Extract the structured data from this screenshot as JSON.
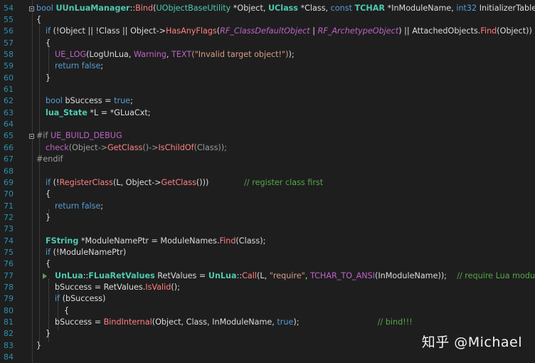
{
  "editor": {
    "lines": [
      {
        "n": "54",
        "segs": [
          [
            "kw",
            "bool "
          ],
          [
            "tyb",
            "UUnLuaManager"
          ],
          [
            "id",
            "::"
          ],
          [
            "fn",
            "Bind"
          ],
          [
            "id",
            "("
          ],
          [
            "ty",
            "UObjectBaseUtility"
          ],
          [
            "id",
            " *Object, "
          ],
          [
            "tyb",
            "UClass"
          ],
          [
            "id",
            " *Class, "
          ],
          [
            "kw",
            "const "
          ],
          [
            "tyb",
            "TCHAR"
          ],
          [
            "id",
            " *InModuleName, "
          ],
          [
            "kw",
            "int32"
          ],
          [
            "id",
            " InitializerTableRef)"
          ]
        ]
      },
      {
        "n": "55",
        "segs": [
          [
            "id",
            "{"
          ]
        ]
      },
      {
        "n": "56",
        "segs": [
          [
            "kw",
            "if "
          ],
          [
            "id",
            "(!Object || !Class || Object->"
          ],
          [
            "fn",
            "HasAnyFlags"
          ],
          [
            "id",
            "("
          ],
          [
            "macb",
            "RF_ClassDefaultObject"
          ],
          [
            "id",
            " | "
          ],
          [
            "macb",
            "RF_ArchetypeObject"
          ],
          [
            "id",
            ") || AttachedObjects."
          ],
          [
            "fn",
            "Find"
          ],
          [
            "id",
            "(Object))"
          ]
        ]
      },
      {
        "n": "57",
        "segs": [
          [
            "id",
            "{"
          ]
        ]
      },
      {
        "n": "58",
        "segs": [
          [
            "mac",
            "UE_LOG"
          ],
          [
            "id",
            "(LogUnLua, "
          ],
          [
            "mac",
            "Warning"
          ],
          [
            "id",
            ", "
          ],
          [
            "mac",
            "TEXT"
          ],
          [
            "str",
            "(\"Invalid target object!\")"
          ],
          [
            "id",
            ");"
          ]
        ]
      },
      {
        "n": "59",
        "segs": [
          [
            "kw",
            "return false"
          ],
          [
            "id",
            ";"
          ]
        ]
      },
      {
        "n": "60",
        "segs": [
          [
            "id",
            "}"
          ]
        ]
      },
      {
        "n": "61",
        "segs": []
      },
      {
        "n": "62",
        "segs": [
          [
            "kw",
            "bool "
          ],
          [
            "id",
            "bSuccess = "
          ],
          [
            "kw",
            "true"
          ],
          [
            "id",
            ";"
          ]
        ]
      },
      {
        "n": "63",
        "segs": [
          [
            "tyb",
            "lua_State"
          ],
          [
            "id",
            " *L = *GLuaCxt;"
          ]
        ]
      },
      {
        "n": "64",
        "segs": []
      },
      {
        "n": "65",
        "segs": [
          [
            "pp",
            "#if "
          ],
          [
            "mac",
            "UE_BUILD_DEBUG"
          ]
        ]
      },
      {
        "n": "66",
        "segs": [
          [
            "mac",
            "check"
          ],
          [
            "pp",
            "(Object->"
          ],
          [
            "fn",
            "GetClass"
          ],
          [
            "pp",
            "()->"
          ],
          [
            "fn",
            "IsChildOf"
          ],
          [
            "pp",
            "(Class));"
          ]
        ]
      },
      {
        "n": "67",
        "segs": [
          [
            "pp",
            "#endif"
          ]
        ]
      },
      {
        "n": "68",
        "segs": []
      },
      {
        "n": "69",
        "segs": [
          [
            "kw",
            "if "
          ],
          [
            "id",
            "(!"
          ],
          [
            "fn",
            "RegisterClass"
          ],
          [
            "id",
            "(L, Object->"
          ],
          [
            "fn",
            "GetClass"
          ],
          [
            "id",
            "()))              "
          ],
          [
            "cm",
            "// register class first"
          ]
        ]
      },
      {
        "n": "70",
        "segs": [
          [
            "id",
            "{"
          ]
        ]
      },
      {
        "n": "71",
        "segs": [
          [
            "kw",
            "return false"
          ],
          [
            "id",
            ";"
          ]
        ]
      },
      {
        "n": "72",
        "segs": [
          [
            "id",
            "}"
          ]
        ]
      },
      {
        "n": "73",
        "segs": []
      },
      {
        "n": "74",
        "segs": [
          [
            "tyb",
            "FString"
          ],
          [
            "id",
            " *ModuleNamePtr = ModuleNames."
          ],
          [
            "fn",
            "Find"
          ],
          [
            "id",
            "(Class);"
          ]
        ]
      },
      {
        "n": "75",
        "segs": [
          [
            "kw",
            "if "
          ],
          [
            "id",
            "(!ModuleNamePtr)"
          ]
        ]
      },
      {
        "n": "76",
        "segs": [
          [
            "id",
            "{"
          ]
        ]
      },
      {
        "n": "77",
        "segs": [
          [
            "tyb",
            "UnLua"
          ],
          [
            "id",
            "::"
          ],
          [
            "tyb",
            "FLuaRetValues"
          ],
          [
            "id",
            " RetValues = "
          ],
          [
            "tyb",
            "UnLua"
          ],
          [
            "id",
            "::"
          ],
          [
            "fn",
            "Call"
          ],
          [
            "id",
            "(L, "
          ],
          [
            "str",
            "\"require\""
          ],
          [
            "id",
            ", "
          ],
          [
            "mac",
            "TCHAR_TO_ANSI"
          ],
          [
            "id",
            "(InModuleName));    "
          ],
          [
            "cm",
            "// require Lua module"
          ]
        ]
      },
      {
        "n": "78",
        "segs": [
          [
            "id",
            "bSuccess = RetValues."
          ],
          [
            "fn",
            "IsValid"
          ],
          [
            "id",
            "();"
          ]
        ]
      },
      {
        "n": "79",
        "segs": [
          [
            "kw",
            "if "
          ],
          [
            "id",
            "(bSuccess)"
          ]
        ]
      },
      {
        "n": "80",
        "segs": [
          [
            "id",
            "{"
          ]
        ]
      },
      {
        "n": "81",
        "segs": [
          [
            "id",
            "bSuccess = "
          ],
          [
            "fn",
            "BindInternal"
          ],
          [
            "id",
            "(Object, Class, InModuleName, "
          ],
          [
            "kw",
            "true"
          ],
          [
            "id",
            ");                               "
          ],
          [
            "cm",
            "// bind!!!"
          ]
        ]
      },
      {
        "n": "82",
        "segs": [
          [
            "id",
            "}"
          ]
        ]
      },
      {
        "n": "83",
        "segs": [
          [
            "id",
            "}"
          ]
        ]
      },
      {
        "n": "84",
        "segs": []
      }
    ]
  },
  "watermark": "知乎 @Michael"
}
